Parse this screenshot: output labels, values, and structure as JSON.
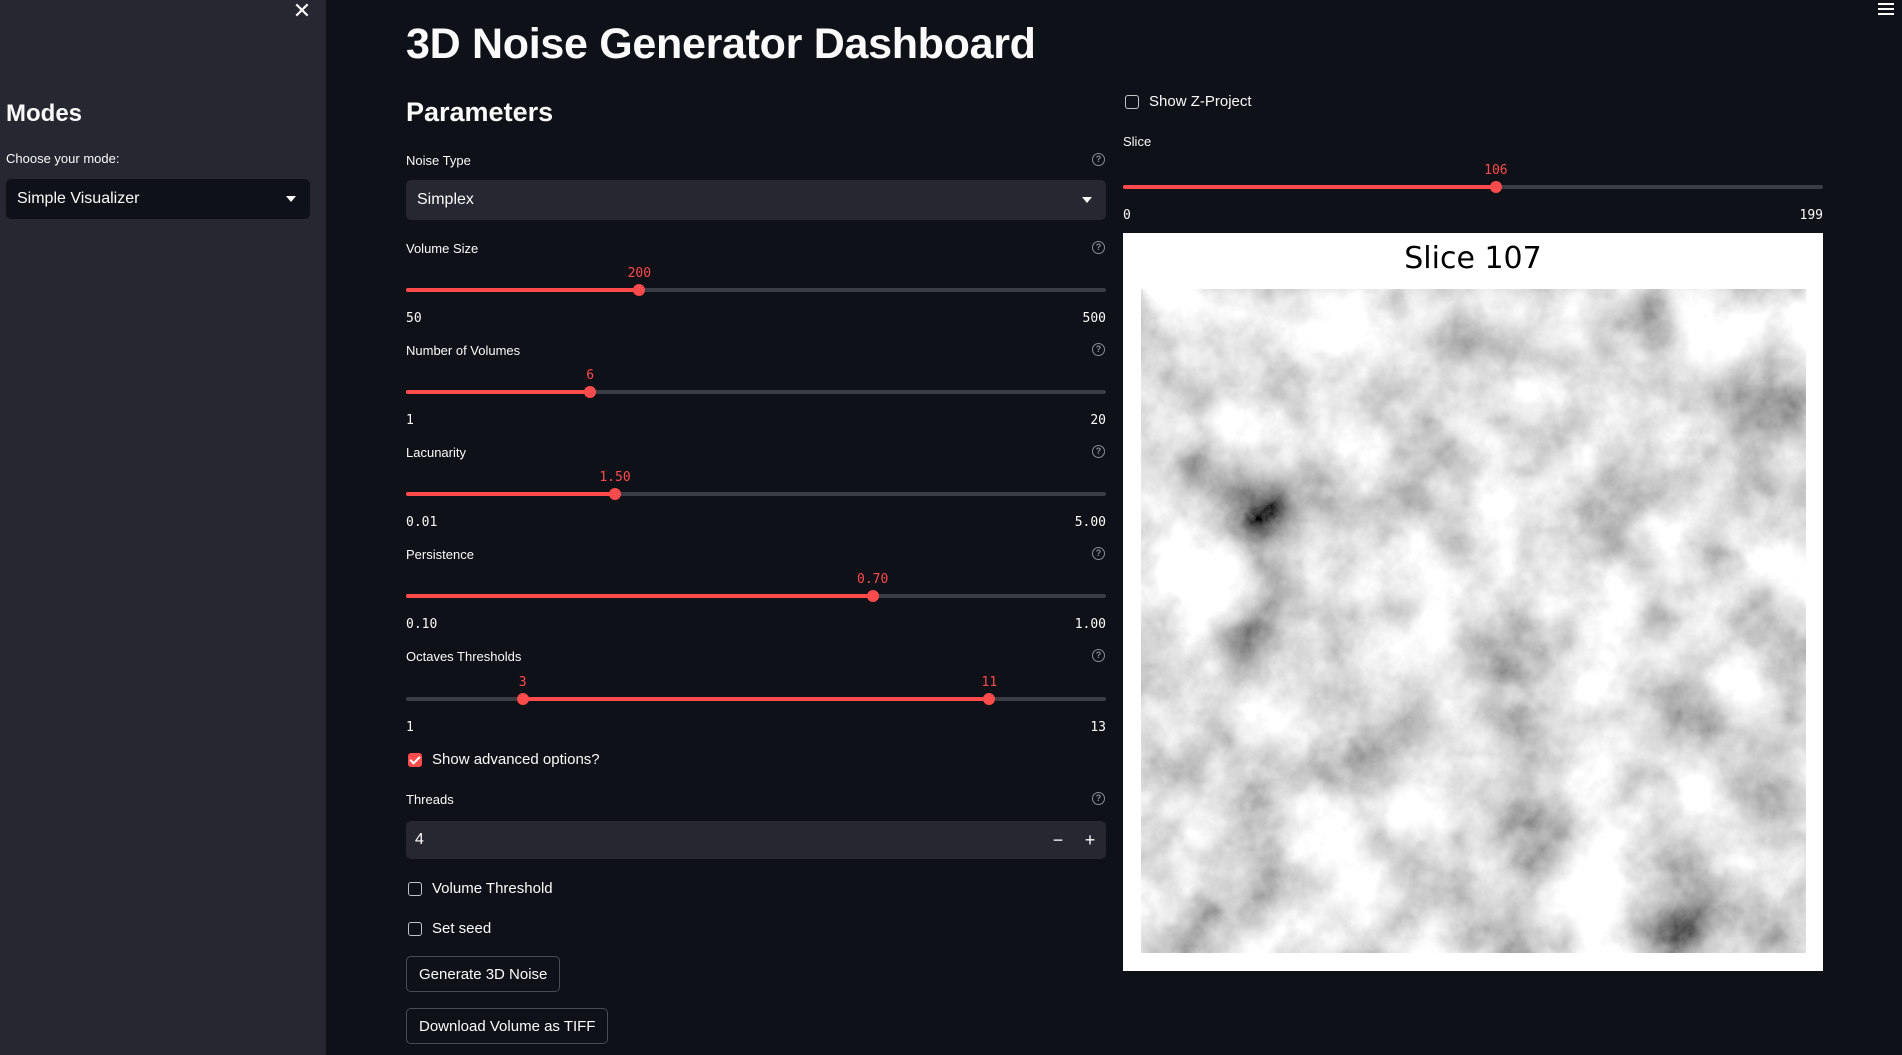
{
  "sidebar": {
    "heading": "Modes",
    "mode_label": "Choose your mode:",
    "mode_value": "Simple Visualizer"
  },
  "main": {
    "title": "3D Noise Generator Dashboard",
    "parameters_heading": "Parameters",
    "noise_type": {
      "label": "Noise Type",
      "value": "Simplex"
    },
    "sliders": {
      "volume_size": {
        "label": "Volume Size",
        "min": "50",
        "max": "500",
        "value": "200",
        "min_n": 50,
        "max_n": 500,
        "value_n": 200
      },
      "num_volumes": {
        "label": "Number of Volumes",
        "min": "1",
        "max": "20",
        "value": "6",
        "min_n": 1,
        "max_n": 20,
        "value_n": 6
      },
      "lacunarity": {
        "label": "Lacunarity",
        "min": "0.01",
        "max": "5.00",
        "value": "1.50",
        "min_n": 0.01,
        "max_n": 5.0,
        "value_n": 1.5
      },
      "persistence": {
        "label": "Persistence",
        "min": "0.10",
        "max": "1.00",
        "value": "0.70",
        "min_n": 0.1,
        "max_n": 1.0,
        "value_n": 0.7
      },
      "octaves": {
        "label": "Octaves Thresholds",
        "min": "1",
        "max": "13",
        "low": "3",
        "high": "11",
        "min_n": 1,
        "max_n": 13,
        "low_n": 3,
        "high_n": 11
      }
    },
    "advanced_label": "Show advanced options?",
    "advanced_checked": true,
    "threads": {
      "label": "Threads",
      "value": "4",
      "minus": "−",
      "plus": "+"
    },
    "volume_threshold_label": "Volume Threshold",
    "set_seed_label": "Set seed",
    "generate_button": "Generate 3D Noise",
    "download_button": "Download Volume as TIFF"
  },
  "right": {
    "z_project_label": "Show Z-Project",
    "slice": {
      "label": "Slice",
      "min": "0",
      "max": "199",
      "value": "106",
      "min_n": 0,
      "max_n": 199,
      "value_n": 106
    },
    "plot_title": "Slice 107"
  },
  "icons": {
    "close": "close-icon",
    "menu": "hamburger-menu-icon",
    "help": "help-circle-icon",
    "dropdown": "chevron-down-icon"
  },
  "colors": {
    "accent": "#ff4b4b",
    "background": "#0e1117",
    "sidebar": "#262730"
  }
}
